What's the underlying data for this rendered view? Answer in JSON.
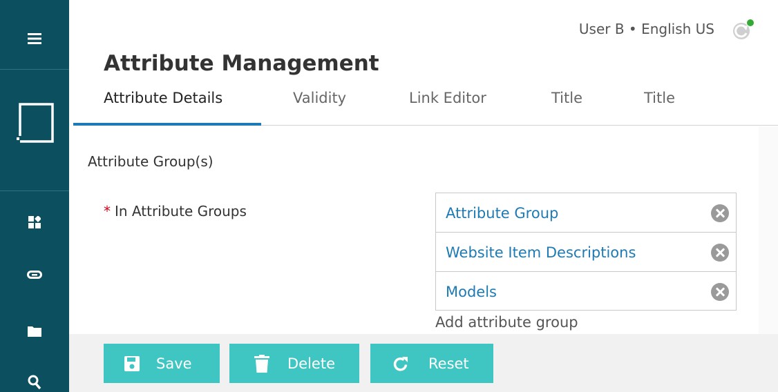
{
  "header": {
    "user_info": "User B • English US",
    "status_color": "#33aa33"
  },
  "page": {
    "title": "Attribute Management"
  },
  "tabs": [
    {
      "label": "Attribute Details",
      "active": true
    },
    {
      "label": "Validity"
    },
    {
      "label": "Link Editor"
    },
    {
      "label": "Title"
    },
    {
      "label": "Title"
    }
  ],
  "section": {
    "label": "Attribute Group(s)",
    "field": {
      "required_mark": "*",
      "label": "In Attribute Groups",
      "groups": [
        "Attribute Group",
        "Website Item Descriptions",
        "Models"
      ],
      "add_label": "Add attribute group"
    }
  },
  "sidebar": {
    "icons": [
      "menu-icon",
      "workspace-icon",
      "dashboard-icon",
      "link-icon",
      "folder-icon",
      "search-icon"
    ]
  },
  "actions": {
    "save": "Save",
    "delete": "Delete",
    "reset": "Reset"
  },
  "colors": {
    "sidebar": "#0c4f5e",
    "accent": "#1d7ab4",
    "button": "#3fc6c2",
    "required": "#d0021b"
  }
}
